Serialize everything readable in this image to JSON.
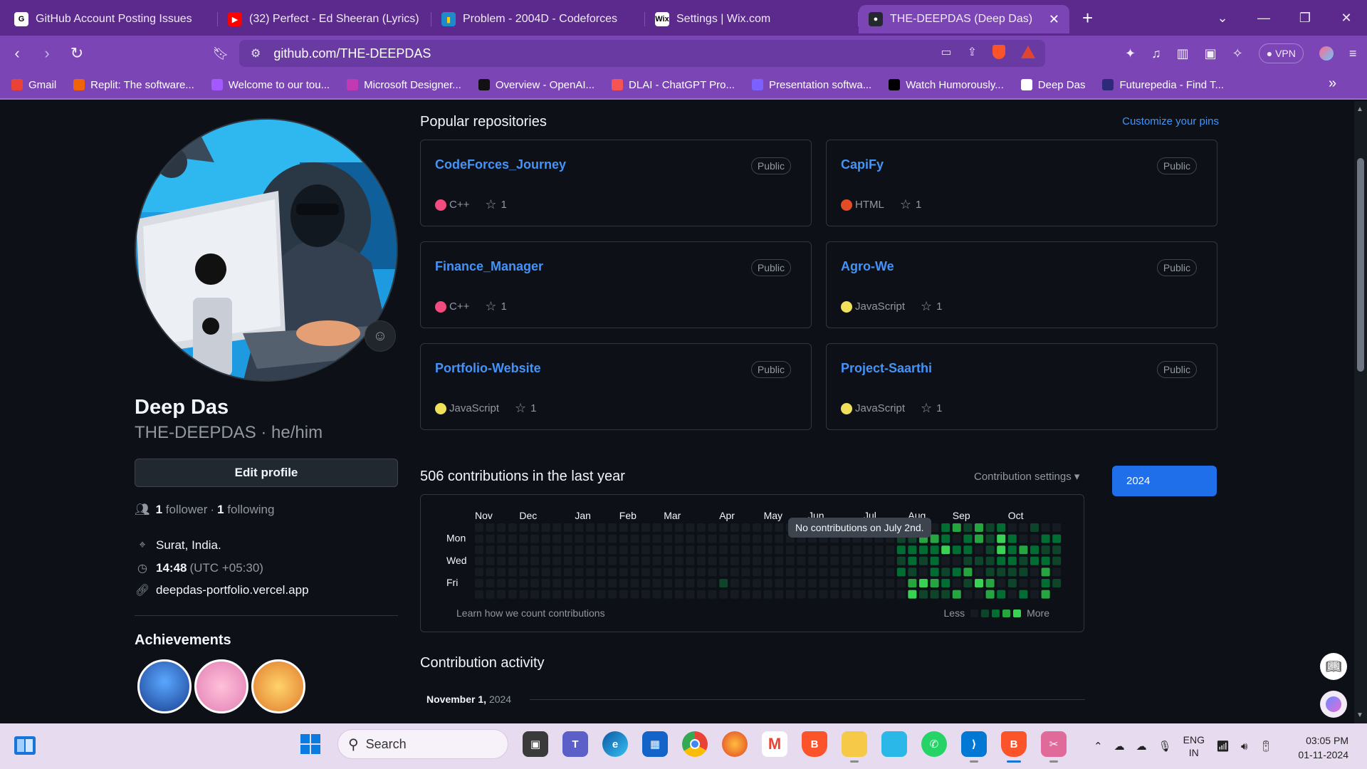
{
  "browser": {
    "tabs": [
      {
        "title": "GitHub Account Posting Issues",
        "fav": "G",
        "fav_bg": "#ffffff",
        "fav_color": "#000000"
      },
      {
        "title": "(32) Perfect - Ed Sheeran (Lyrics)",
        "fav": "▶",
        "fav_bg": "#ff0000",
        "fav_color": "#ffffff"
      },
      {
        "title": "Problem - 2004D - Codeforces",
        "fav": "▮",
        "fav_bg": "#1f8acb",
        "fav_color": "#ffcc00"
      },
      {
        "title": "Settings | Wix.com",
        "fav": "Wix",
        "fav_bg": "#ffffff",
        "fav_color": "#000000"
      },
      {
        "title": "THE-DEEPDAS (Deep Das)",
        "fav": "●",
        "fav_bg": "#24292f",
        "fav_color": "#ffffff"
      }
    ],
    "url": "github.com/THE-DEEPDAS",
    "vpn_label": "VPN",
    "bookmarks": [
      {
        "label": "Gmail",
        "color": "#ea4335"
      },
      {
        "label": "Replit: The software...",
        "color": "#f26207"
      },
      {
        "label": "Welcome to our tou...",
        "color": "#a259ff"
      },
      {
        "label": "Microsoft Designer...",
        "color": "#c239b3"
      },
      {
        "label": "Overview - OpenAI...",
        "color": "#111111"
      },
      {
        "label": "DLAI - ChatGPT Pro...",
        "color": "#f65353"
      },
      {
        "label": "Presentation softwa...",
        "color": "#7b61ff"
      },
      {
        "label": "Watch Humorously...",
        "color": "#000000"
      },
      {
        "label": "Deep Das",
        "color": "#ffffff"
      },
      {
        "label": "Futurepedia - Find T...",
        "color": "#2e2a7a"
      }
    ]
  },
  "profile": {
    "name": "Deep Das",
    "login": "THE-DEEPDAS · he/him",
    "edit_label": "Edit profile",
    "followers_count": "1",
    "followers_label": "follower",
    "following_count": "1",
    "following_label": "following",
    "location": "Surat, India.",
    "time": "14:48",
    "timezone": "(UTC +05:30)",
    "website": "deepdas-portfolio.vercel.app",
    "achievements_title": "Achievements"
  },
  "repos": {
    "title": "Popular repositories",
    "customize": "Customize your pins",
    "items": [
      {
        "name": "CodeForces_Journey",
        "visibility": "Public",
        "language": "C++",
        "color": "#f34b7d",
        "stars": "1"
      },
      {
        "name": "CapiFy",
        "visibility": "Public",
        "language": "HTML",
        "color": "#e34c26",
        "stars": "1"
      },
      {
        "name": "Finance_Manager",
        "visibility": "Public",
        "language": "C++",
        "color": "#f34b7d",
        "stars": "1"
      },
      {
        "name": "Agro-We",
        "visibility": "Public",
        "language": "JavaScript",
        "color": "#f1e05a",
        "stars": "1"
      },
      {
        "name": "Portfolio-Website",
        "visibility": "Public",
        "language": "JavaScript",
        "color": "#f1e05a",
        "stars": "1"
      },
      {
        "name": "Project-Saarthi",
        "visibility": "Public",
        "language": "JavaScript",
        "color": "#f1e05a",
        "stars": "1"
      }
    ]
  },
  "contributions": {
    "title": "506 contributions in the last year",
    "settings": "Contribution settings ▾",
    "year": "2024",
    "months": [
      "Nov",
      "Dec",
      "Jan",
      "Feb",
      "Mar",
      "Apr",
      "May",
      "Jun",
      "Jul",
      "Aug",
      "Sep",
      "Oct"
    ],
    "days": [
      "Mon",
      "Wed",
      "Fri"
    ],
    "tooltip": "No contributions on July 2nd.",
    "learn": "Learn how we count contributions",
    "less": "Less",
    "more": "More",
    "colors": [
      "#161b22",
      "#0e4429",
      "#006d32",
      "#26a641",
      "#39d353"
    ]
  },
  "activity": {
    "title": "Contribution activity",
    "date_bold": "November 1,",
    "date_year": "2024"
  },
  "taskbar": {
    "search": "Search",
    "lang_top": "ENG",
    "lang_bottom": "IN",
    "time": "03:05 PM",
    "date": "01-11-2024"
  }
}
